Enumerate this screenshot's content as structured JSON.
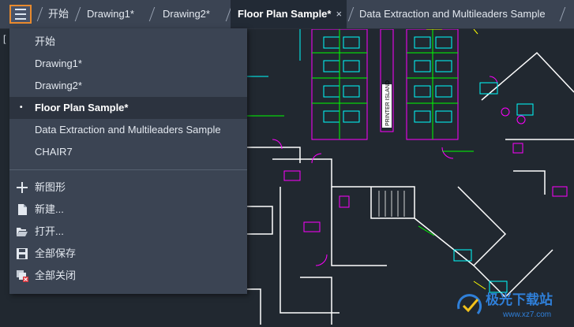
{
  "tabs": [
    {
      "label": "开始"
    },
    {
      "label": "Drawing1*"
    },
    {
      "label": "Drawing2*"
    },
    {
      "label": "Floor Plan Sample*",
      "close": "×"
    },
    {
      "label": "Data Extraction and Multileaders Sample"
    }
  ],
  "viewport_label": "[",
  "menu": {
    "open_drawings": [
      {
        "label": "开始"
      },
      {
        "label": "Drawing1*"
      },
      {
        "label": "Drawing2*"
      },
      {
        "label": "Floor Plan Sample*",
        "bullet": "•"
      },
      {
        "label": "Data Extraction and Multileaders Sample"
      },
      {
        "label": "CHAIR7"
      }
    ],
    "actions": [
      {
        "label": "新图形",
        "icon": "plus-icon"
      },
      {
        "label": "新建...",
        "icon": "new-file-icon"
      },
      {
        "label": "打开...",
        "icon": "open-folder-icon"
      },
      {
        "label": "全部保存",
        "icon": "save-icon"
      },
      {
        "label": "全部关闭",
        "icon": "close-all-icon"
      }
    ]
  },
  "drawing": {
    "printer_label": "PRINTER ISLAND"
  },
  "watermark": {
    "text": "极光下载站",
    "url_text": "www.xz7.com"
  },
  "colors": {
    "accent": "#e98a2e",
    "canvas": "#212830",
    "magenta": "#ff00ff",
    "cyan": "#00ffff",
    "green": "#00ff00",
    "yellow": "#ffff00"
  }
}
